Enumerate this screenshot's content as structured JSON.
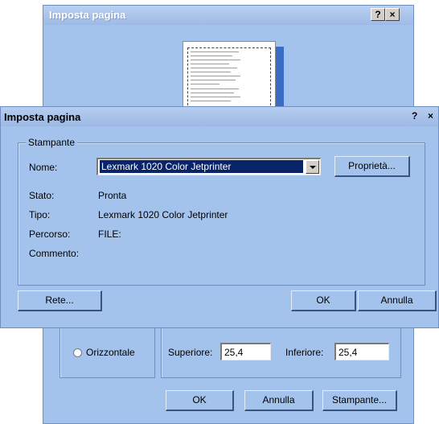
{
  "background_dialog": {
    "title": "Imposta pagina",
    "help_label": "?",
    "close_label": "×",
    "orientation_horizontal_label": "Orizzontale",
    "margin_top_label": "Superiore:",
    "margin_top_value": "25,4",
    "margin_bottom_label": "Inferiore:",
    "margin_bottom_value": "25,4",
    "ok_label": "OK",
    "cancel_label": "Annulla",
    "printer_label": "Stampante..."
  },
  "dialog": {
    "title": "Imposta pagina",
    "help_label": "?",
    "close_label": "×",
    "group_label": "Stampante",
    "name_label": "Nome:",
    "name_value": "Lexmark 1020 Color Jetprinter",
    "properties_label": "Proprietà...",
    "status_label": "Stato:",
    "status_value": "Pronta",
    "type_label": "Tipo:",
    "type_value": "Lexmark 1020 Color Jetprinter",
    "path_label": "Percorso:",
    "path_value": "FILE:",
    "comment_label": "Commento:",
    "comment_value": "",
    "network_label": "Rete...",
    "ok_label": "OK",
    "cancel_label": "Annulla"
  }
}
